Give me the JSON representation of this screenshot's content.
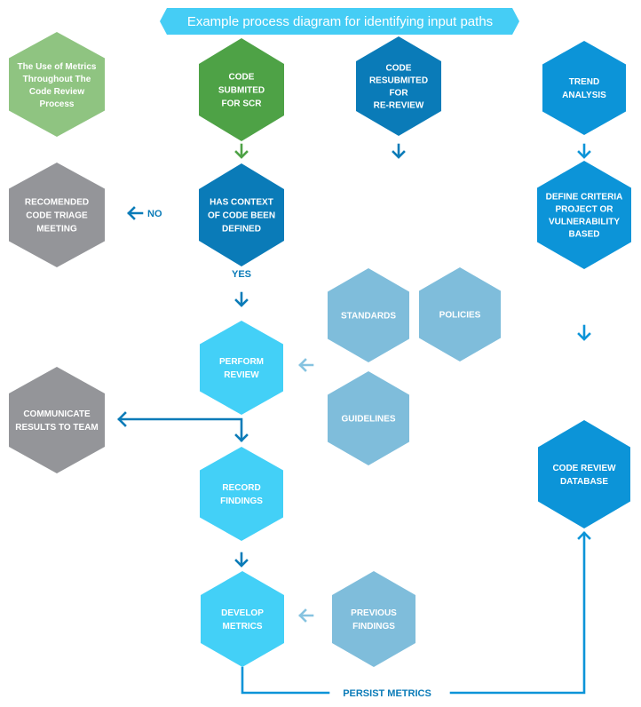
{
  "title": "Example process diagram for identifying input paths",
  "colors": {
    "title_banner": "#45cdf5",
    "light_green": "#8fc481",
    "green": "#4ea246",
    "dark_blue": "#0a7bb8",
    "mid_blue": "#0c94d8",
    "sky_blue": "#43d0f7",
    "pale_blue": "#7fbddb",
    "grey": "#949599",
    "arrow_dark": "#0a7bb8",
    "arrow_pale": "#86c3e0",
    "arrow_green": "#4ea246",
    "arrow_mid": "#0c94d8"
  },
  "nodes": {
    "use_of_metrics": {
      "lines": [
        "The Use of Metrics",
        "Throughout The",
        "Code Review",
        "Process"
      ]
    },
    "code_submitted": {
      "lines": [
        "CODE",
        "SUBMITED",
        "FOR SCR"
      ]
    },
    "code_resubmitted": {
      "lines": [
        "CODE",
        "RESUBMITED",
        "FOR",
        "RE-REVIEW"
      ]
    },
    "trend_analysis": {
      "lines": [
        "TREND",
        "ANALYSIS"
      ]
    },
    "triage_meeting": {
      "lines": [
        "RECOMENDED",
        "CODE TRIAGE",
        "MEETING"
      ]
    },
    "context_defined": {
      "lines": [
        "HAS CONTEXT",
        "OF CODE BEEN",
        "DEFINED"
      ]
    },
    "define_criteria": {
      "lines": [
        "DEFINE CRITERIA",
        "PROJECT OR",
        "VULNERABILITY",
        "BASED"
      ]
    },
    "standards": {
      "lines": [
        "STANDARDS"
      ]
    },
    "policies": {
      "lines": [
        "POLICIES"
      ]
    },
    "perform_review": {
      "lines": [
        "PERFORM",
        "REVIEW"
      ]
    },
    "guidelines": {
      "lines": [
        "GUIDELINES"
      ]
    },
    "communicate_results": {
      "lines": [
        "COMMUNICATE",
        "RESULTS TO TEAM"
      ]
    },
    "record_findings": {
      "lines": [
        "RECORD",
        "FINDINGS"
      ]
    },
    "code_review_database": {
      "lines": [
        "CODE REVIEW",
        "DATABASE"
      ]
    },
    "develop_metrics": {
      "lines": [
        "DEVELOP",
        "METRICS"
      ]
    },
    "previous_findings": {
      "lines": [
        "PREVIOUS",
        "FINDINGS"
      ]
    }
  },
  "labels": {
    "no": "NO",
    "yes": "YES",
    "persist_metrics": "PERSIST METRICS"
  }
}
